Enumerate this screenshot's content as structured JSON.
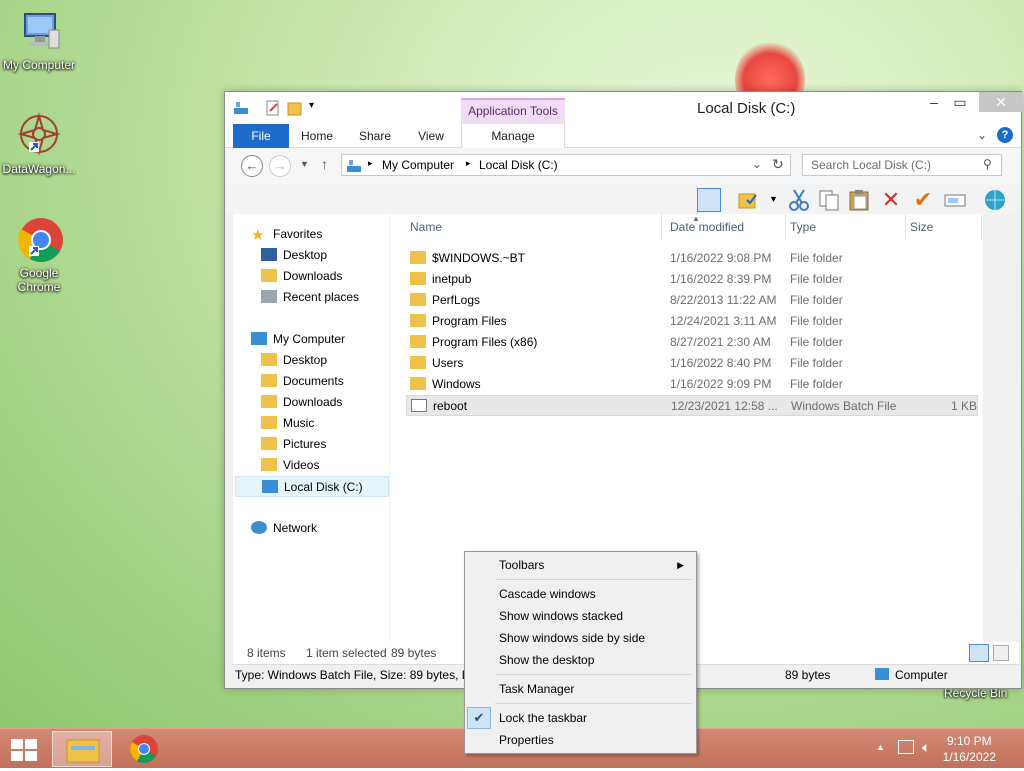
{
  "desktop": {
    "icons": [
      {
        "label": "My Computer"
      },
      {
        "label": "DataWagon..."
      },
      {
        "label": "Google Chrome"
      }
    ],
    "recycle_label": "Recycle Bin"
  },
  "window": {
    "title": "Local Disk (C:)",
    "contextual_tab_group": "Application Tools",
    "ribbon_tabs": [
      "File",
      "Home",
      "Share",
      "View",
      "Manage"
    ],
    "address": {
      "crumbs": [
        "My Computer",
        "Local Disk (C:)"
      ]
    },
    "search_placeholder": "Search Local Disk (C:)",
    "nav": {
      "favorites": "Favorites",
      "fav_items": [
        "Desktop",
        "Downloads",
        "Recent places"
      ],
      "computer": "My Computer",
      "computer_items": [
        "Desktop",
        "Documents",
        "Downloads",
        "Music",
        "Pictures",
        "Videos",
        "Local Disk (C:)"
      ],
      "network": "Network"
    },
    "columns": {
      "name": "Name",
      "date": "Date modified",
      "type": "Type",
      "size": "Size"
    },
    "files": [
      {
        "name": "$WINDOWS.~BT",
        "date": "1/16/2022 9:08 PM",
        "type": "File folder",
        "size": ""
      },
      {
        "name": "inetpub",
        "date": "1/16/2022 8:39 PM",
        "type": "File folder",
        "size": ""
      },
      {
        "name": "PerfLogs",
        "date": "8/22/2013 11:22 AM",
        "type": "File folder",
        "size": ""
      },
      {
        "name": "Program Files",
        "date": "12/24/2021 3:11 AM",
        "type": "File folder",
        "size": ""
      },
      {
        "name": "Program Files (x86)",
        "date": "8/27/2021 2:30 AM",
        "type": "File folder",
        "size": ""
      },
      {
        "name": "Users",
        "date": "1/16/2022 8:40 PM",
        "type": "File folder",
        "size": ""
      },
      {
        "name": "Windows",
        "date": "1/16/2022 9:09 PM",
        "type": "File folder",
        "size": ""
      },
      {
        "name": "reboot",
        "date": "12/23/2021 12:58 ...",
        "type": "Windows Batch File",
        "size": "1 KB"
      }
    ],
    "status": {
      "items": "8 items",
      "selected": "1 item selected",
      "bytes": "89 bytes"
    },
    "details": {
      "left": "Type: Windows Batch File, Size: 89 bytes, Da",
      "size": "89 bytes",
      "location": "Computer"
    }
  },
  "context_menu": {
    "items": [
      {
        "label": "Toolbars",
        "submenu": true
      },
      {
        "label": "Cascade windows"
      },
      {
        "label": "Show windows stacked"
      },
      {
        "label": "Show windows side by side"
      },
      {
        "label": "Show the desktop"
      },
      {
        "label": "Task Manager"
      },
      {
        "label": "Lock the taskbar",
        "checked": true
      },
      {
        "label": "Properties"
      }
    ]
  },
  "taskbar": {
    "time": "9:10 PM",
    "date": "1/16/2022"
  },
  "colors": {
    "accent": "#1e6cc8",
    "taskbar": "#c1705a"
  }
}
